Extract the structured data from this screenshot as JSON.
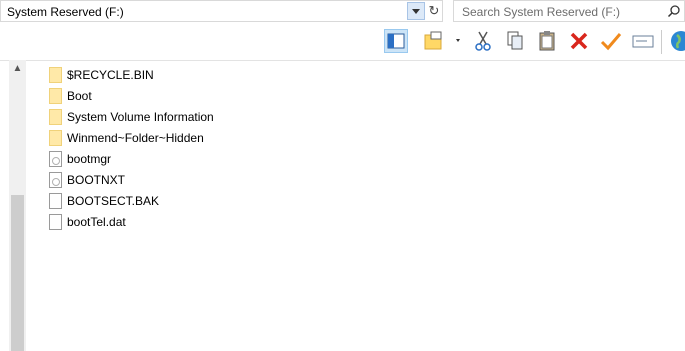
{
  "address": {
    "value": "System Reserved (F:)",
    "dropdown_icon": "chevron-down-icon",
    "refresh_icon": "refresh-icon"
  },
  "search": {
    "placeholder": "Search System Reserved (F:)",
    "icon": "search-icon"
  },
  "toolbar": {
    "buttons": [
      "layout-pane-icon",
      "new-folder-icon",
      "cut-icon",
      "copy-icon",
      "paste-icon",
      "delete-icon",
      "check-icon",
      "rename-icon",
      "globe-icon"
    ]
  },
  "files": [
    {
      "name": "$RECYCLE.BIN",
      "type": "folder"
    },
    {
      "name": "Boot",
      "type": "folder"
    },
    {
      "name": "System Volume Information",
      "type": "folder"
    },
    {
      "name": "Winmend~Folder~Hidden",
      "type": "folder"
    },
    {
      "name": "bootmgr",
      "type": "system-file"
    },
    {
      "name": "BOOTNXT",
      "type": "system-file"
    },
    {
      "name": "BOOTSECT.BAK",
      "type": "file"
    },
    {
      "name": "bootTel.dat",
      "type": "file"
    }
  ],
  "scrollbar": {
    "up_icon": "scroll-up-icon"
  }
}
